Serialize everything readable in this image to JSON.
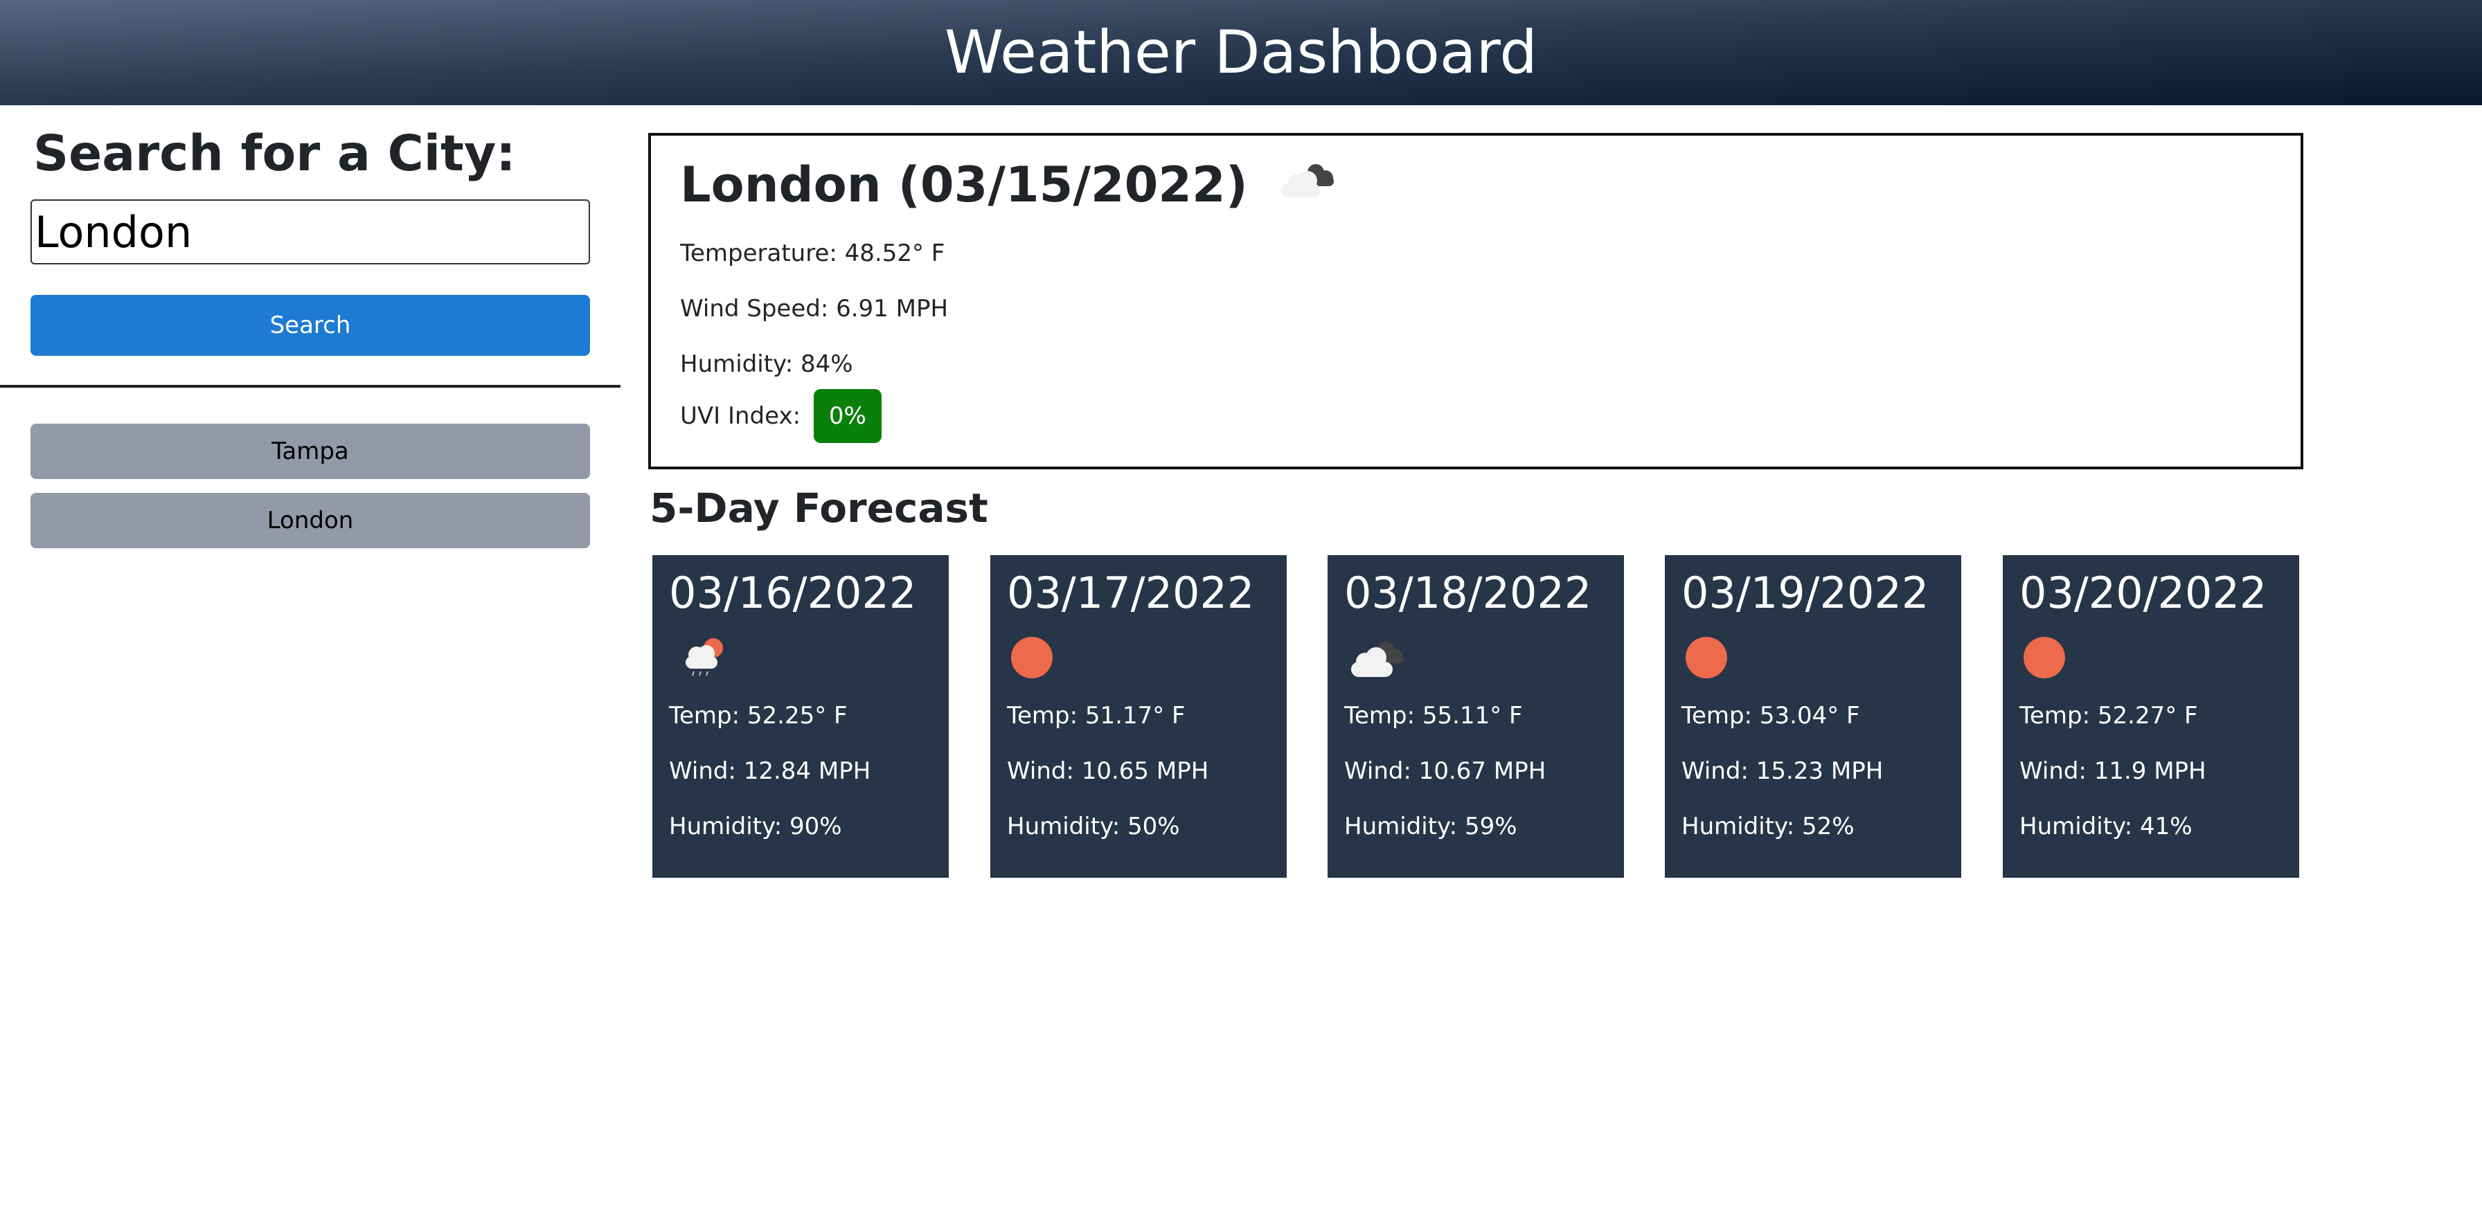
{
  "header": {
    "title": "Weather Dashboard"
  },
  "search": {
    "heading": "Search for a City:",
    "input_value": "London",
    "button_label": "Search"
  },
  "history": [
    {
      "label": "Tampa"
    },
    {
      "label": "London"
    }
  ],
  "current": {
    "title": "London (03/15/2022)",
    "icon": "cloudy-icon",
    "temperature": "Temperature: 48.52° F",
    "wind": "Wind Speed: 6.91 MPH",
    "humidity": "Humidity: 84%",
    "uvi_label": "UVI Index:",
    "uvi_value": "0%",
    "uvi_color": "#0a800a"
  },
  "forecast": {
    "heading": "5-Day Forecast",
    "days": [
      {
        "date": "03/16/2022",
        "icon": "rain-cloud-sun-icon",
        "temp": "Temp: 52.25° F",
        "wind": "Wind: 12.84 MPH",
        "humidity": "Humidity: 90%"
      },
      {
        "date": "03/17/2022",
        "icon": "sun-icon",
        "temp": "Temp: 51.17° F",
        "wind": "Wind: 10.65 MPH",
        "humidity": "Humidity: 50%"
      },
      {
        "date": "03/18/2022",
        "icon": "cloudy-icon",
        "temp": "Temp: 55.11° F",
        "wind": "Wind: 10.67 MPH",
        "humidity": "Humidity: 59%"
      },
      {
        "date": "03/19/2022",
        "icon": "sun-icon",
        "temp": "Temp: 53.04° F",
        "wind": "Wind: 15.23 MPH",
        "humidity": "Humidity: 52%"
      },
      {
        "date": "03/20/2022",
        "icon": "sun-icon",
        "temp": "Temp: 52.27° F",
        "wind": "Wind: 11.9 MPH",
        "humidity": "Humidity: 41%"
      }
    ]
  },
  "colors": {
    "accent": "#1e7bd4",
    "history_button": "#9399a6",
    "card_bg": "#263547",
    "sun": "#ee6a4d"
  }
}
